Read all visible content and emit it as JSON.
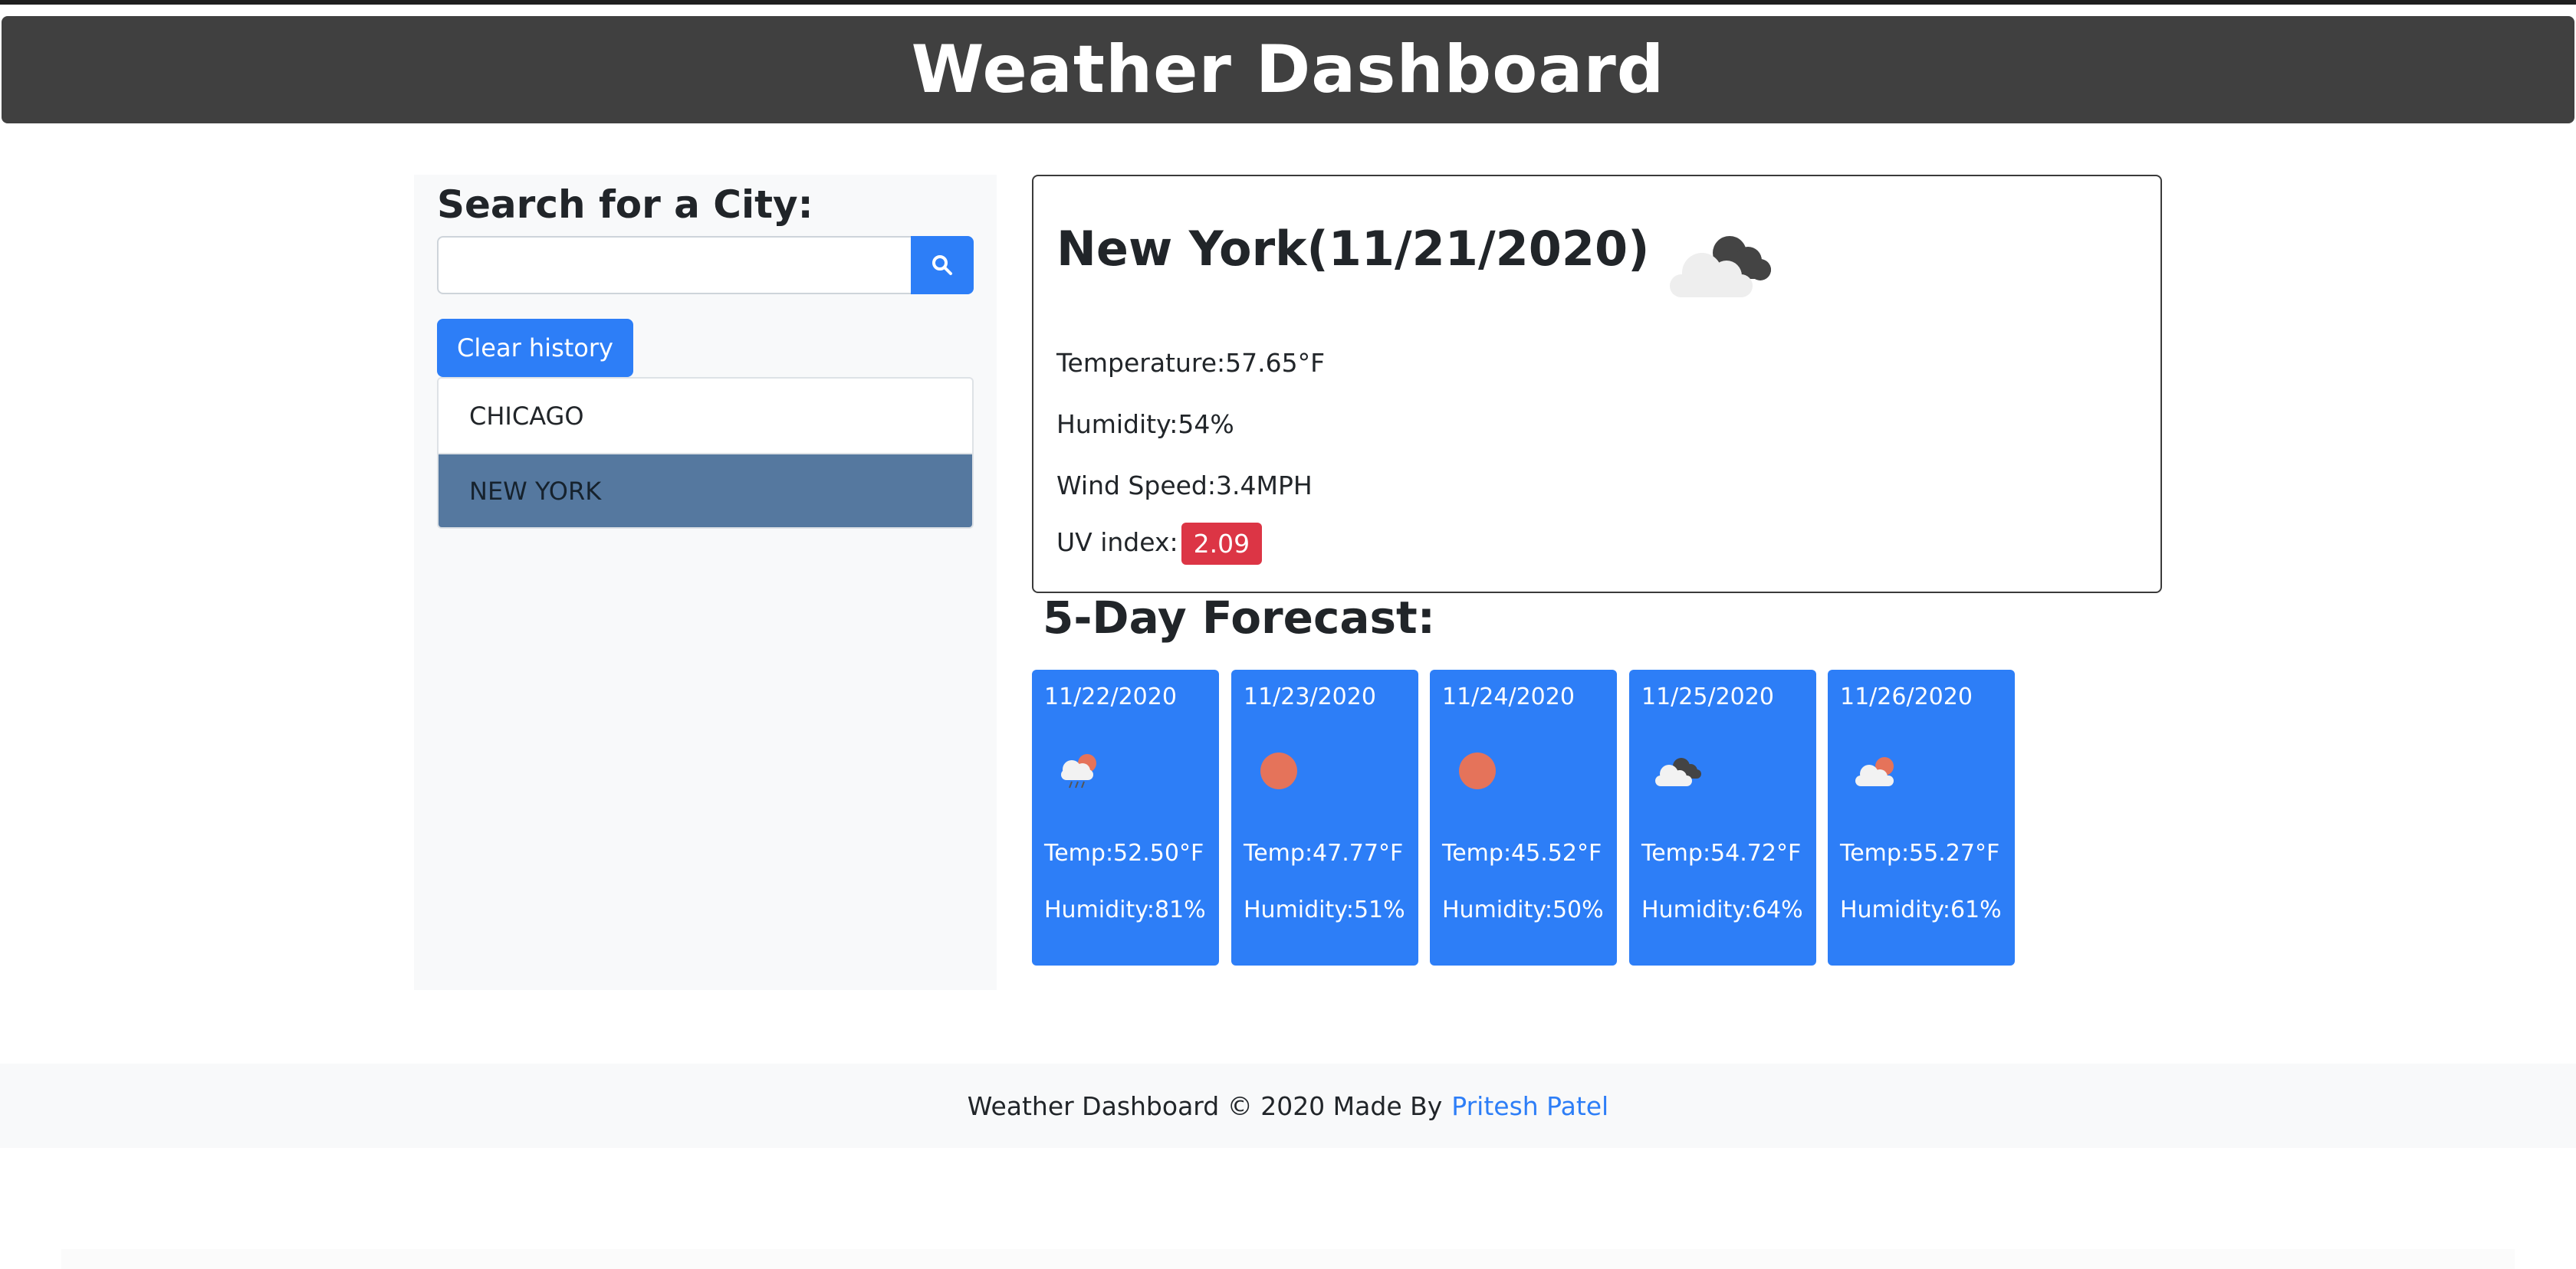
{
  "header": {
    "title": "Weather Dashboard"
  },
  "sidebar": {
    "search_title": "Search for a City:",
    "search_value": "",
    "search_button_icon": "search-icon",
    "clear_label": "Clear history",
    "history": [
      {
        "label": "CHICAGO",
        "active": false
      },
      {
        "label": "NEW YORK",
        "active": true
      }
    ]
  },
  "current": {
    "title": "New York(11/21/2020)",
    "icon": "broken-clouds-icon",
    "temperature": "Temperature:57.65°F",
    "humidity": "Humidity:54%",
    "wind": "Wind Speed:3.4MPH",
    "uv_label": "UV index:",
    "uv_value": "2.09"
  },
  "forecast": {
    "title": "5-Day Forecast:",
    "days": [
      {
        "date": "11/22/2020",
        "icon": "rain-sun-icon",
        "temp": "Temp:52.50°F",
        "humidity": "Humidity:81%"
      },
      {
        "date": "11/23/2020",
        "icon": "sun-icon",
        "temp": "Temp:47.77°F",
        "humidity": "Humidity:51%"
      },
      {
        "date": "11/24/2020",
        "icon": "sun-icon",
        "temp": "Temp:45.52°F",
        "humidity": "Humidity:50%"
      },
      {
        "date": "11/25/2020",
        "icon": "broken-clouds-icon",
        "temp": "Temp:54.72°F",
        "humidity": "Humidity:64%"
      },
      {
        "date": "11/26/2020",
        "icon": "few-clouds-icon",
        "temp": "Temp:55.27°F",
        "humidity": "Humidity:61%"
      }
    ]
  },
  "footer": {
    "text": "Weather Dashboard © 2020 Made By",
    "link": "Pritesh Patel"
  },
  "colors": {
    "header_bg": "#404040",
    "primary": "#2d7ef7",
    "active_item": "#55789f",
    "uv_badge": "#dc3545",
    "sun": "#e5735a"
  }
}
